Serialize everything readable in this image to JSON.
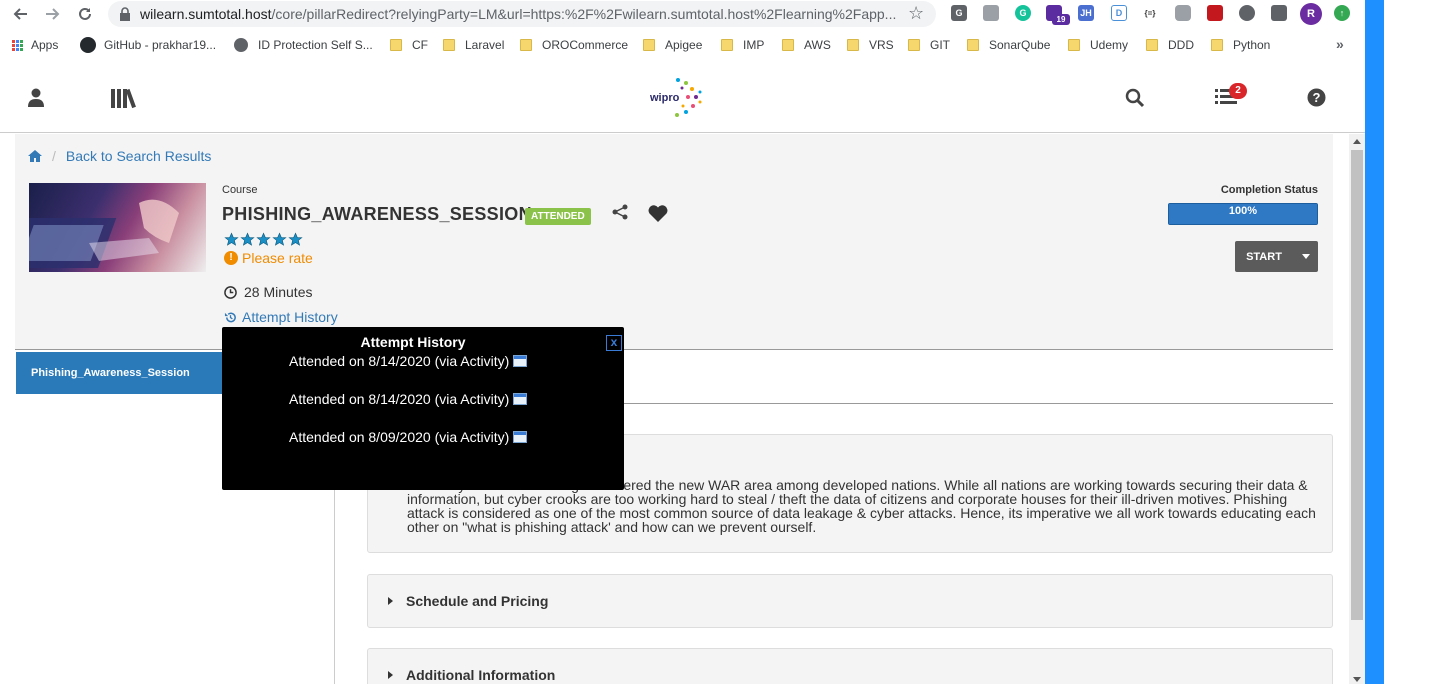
{
  "browser": {
    "url_host": "wilearn.sumtotal.host",
    "url_rest": "/core/pillarRedirect?relyingParty=LM&url=https:%2F%2Fwilearn.sumtotal.host%2Flearning%2Fapp...",
    "extension_badge": "19",
    "extension_jh": "JH",
    "extension_json": "{=}",
    "profile_initial": "R",
    "bookmarks": [
      {
        "label": "Apps",
        "icon": "apps-grid-icon"
      },
      {
        "label": "GitHub - prakhar19...",
        "icon": "github-icon"
      },
      {
        "label": "ID Protection Self S...",
        "icon": "globe-icon"
      },
      {
        "label": "CF",
        "icon": "folder-icon"
      },
      {
        "label": "Laravel",
        "icon": "folder-icon"
      },
      {
        "label": "OROCommerce",
        "icon": "folder-icon"
      },
      {
        "label": "Apigee",
        "icon": "folder-icon"
      },
      {
        "label": "IMP",
        "icon": "folder-icon"
      },
      {
        "label": "AWS",
        "icon": "folder-icon"
      },
      {
        "label": "VRS",
        "icon": "folder-icon"
      },
      {
        "label": "GIT",
        "icon": "folder-icon"
      },
      {
        "label": "SonarQube",
        "icon": "folder-icon"
      },
      {
        "label": "Udemy",
        "icon": "folder-icon"
      },
      {
        "label": "DDD",
        "icon": "folder-icon"
      },
      {
        "label": "Python",
        "icon": "folder-icon"
      }
    ],
    "more": "»"
  },
  "header": {
    "logo_text": "wipro",
    "notification_count": "2"
  },
  "breadcrumb": {
    "back_label": "Back to Search Results"
  },
  "course": {
    "type_label": "Course",
    "title": "PHISHING_AWARENESS_SESSION",
    "status_badge": "ATTENDED",
    "rating_stars": 5,
    "rate_prompt": "Please rate",
    "duration": "28 Minutes",
    "attempt_history_link": "Attempt History"
  },
  "completion": {
    "label": "Completion Status",
    "percent_text": "100%",
    "percent": 100
  },
  "start_button": {
    "label": "START"
  },
  "sidebar": {
    "items": [
      {
        "label": "Phishing_Awareness_Session"
      }
    ]
  },
  "description": {
    "text": "e risk. Cyber attack is being considered the new WAR area among developed nations. While all nations are working towards securing their data & information, but cyber crooks are too working hard to steal / theft the data of citizens and corporate houses for their ill-driven motives. Phishing attack is considered as one of the most common source of data leakage & cyber attacks. Hence, its imperative we all work towards educating each other on \"what is phishing attack' and how can we prevent ourself."
  },
  "accordions": [
    {
      "title": "Schedule and Pricing"
    },
    {
      "title": "Additional Information"
    }
  ],
  "popup": {
    "title": "Attempt History",
    "close": "x",
    "attempts": [
      "Attended on 8/14/2020 (via Activity)",
      "Attended on 8/14/2020 (via Activity)",
      "Attended on 8/09/2020 (via Activity)"
    ]
  },
  "colors": {
    "primary_blue": "#2a7ab9",
    "link_blue": "#337ab7",
    "attended_green": "#8bc34a",
    "warning_orange": "#f08c00",
    "badge_red": "#d9262b"
  }
}
